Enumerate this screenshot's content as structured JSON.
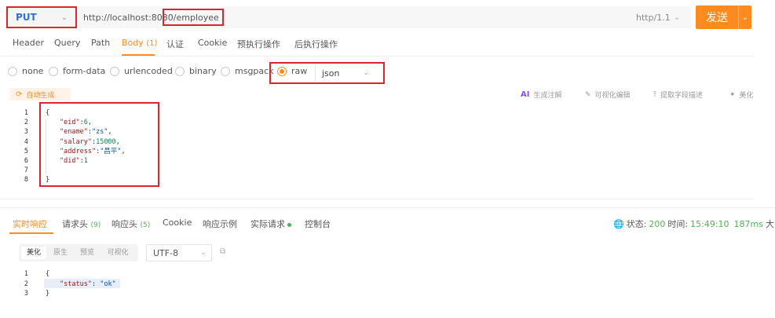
{
  "request": {
    "method": "PUT",
    "url_base": "http://localhost:8080",
    "url_path": "/employee",
    "http_version": "http/1.1",
    "send_label": "发送"
  },
  "tabs": [
    {
      "label": "Header"
    },
    {
      "label": "Query"
    },
    {
      "label": "Path"
    },
    {
      "label": "Body",
      "count": "(1)",
      "active": true
    },
    {
      "label": "认证"
    },
    {
      "label": "Cookie"
    },
    {
      "label": "预执行操作"
    },
    {
      "label": "后执行操作"
    }
  ],
  "body_types": [
    {
      "label": "none"
    },
    {
      "label": "form-data"
    },
    {
      "label": "urlencoded"
    },
    {
      "label": "binary"
    },
    {
      "label": "msgpack"
    },
    {
      "label": "raw",
      "checked": true
    }
  ],
  "raw_format": "json",
  "toolbar": {
    "auto_generate": "自动生成",
    "ai_label": "AI",
    "ai_annotate": "生成注解",
    "visual_edit": "可视化编辑",
    "extract_desc": "提取字段描述",
    "beautify": "美化"
  },
  "request_body_lines": [
    {
      "num": "1",
      "text": "{"
    },
    {
      "num": "2",
      "key": "\"eid\"",
      "sep": ":",
      "value": "6",
      "vtype": "n",
      "tail": ","
    },
    {
      "num": "3",
      "key": "\"ename\"",
      "sep": ":",
      "value": "\"zs\"",
      "vtype": "s",
      "tail": ","
    },
    {
      "num": "4",
      "key": "\"salary\"",
      "sep": ":",
      "value": "15000",
      "vtype": "n",
      "tail": ","
    },
    {
      "num": "5",
      "key": "\"address\"",
      "sep": ":",
      "value": "\"昌平\"",
      "vtype": "s",
      "tail": ","
    },
    {
      "num": "6",
      "key": "\"did\"",
      "sep": ":",
      "value": "1",
      "vtype": "n",
      "tail": ""
    },
    {
      "num": "7",
      "text": ""
    },
    {
      "num": "8",
      "text": "}"
    }
  ],
  "response_tabs": [
    {
      "label": "实时响应",
      "active": true
    },
    {
      "label": "请求头",
      "count": "(9)"
    },
    {
      "label": "响应头",
      "count": "(5)"
    },
    {
      "label": "Cookie"
    },
    {
      "label": "响应示例"
    },
    {
      "label": "实际请求",
      "dot": true
    },
    {
      "label": "控制台"
    }
  ],
  "response_status": {
    "status_label": "状态:",
    "status_value": "200",
    "time_label": "时间:",
    "time_value": "15:49:10",
    "duration": "187ms",
    "overflow": "大"
  },
  "view_modes": [
    {
      "label": "美化",
      "active": true
    },
    {
      "label": "原生"
    },
    {
      "label": "预览"
    },
    {
      "label": "可视化"
    }
  ],
  "encoding": "UTF-8",
  "response_body_lines": [
    {
      "num": "1",
      "text": "{"
    },
    {
      "num": "2",
      "key": "\"status\"",
      "sep": ": ",
      "value": "\"ok\"",
      "vtype": "s",
      "tail": ""
    },
    {
      "num": "3",
      "text": "}"
    }
  ],
  "colors": {
    "accent": "#ff8b1f",
    "method": "#2f6fe5",
    "highlight_box": "#d9262c",
    "success": "#52b352"
  }
}
